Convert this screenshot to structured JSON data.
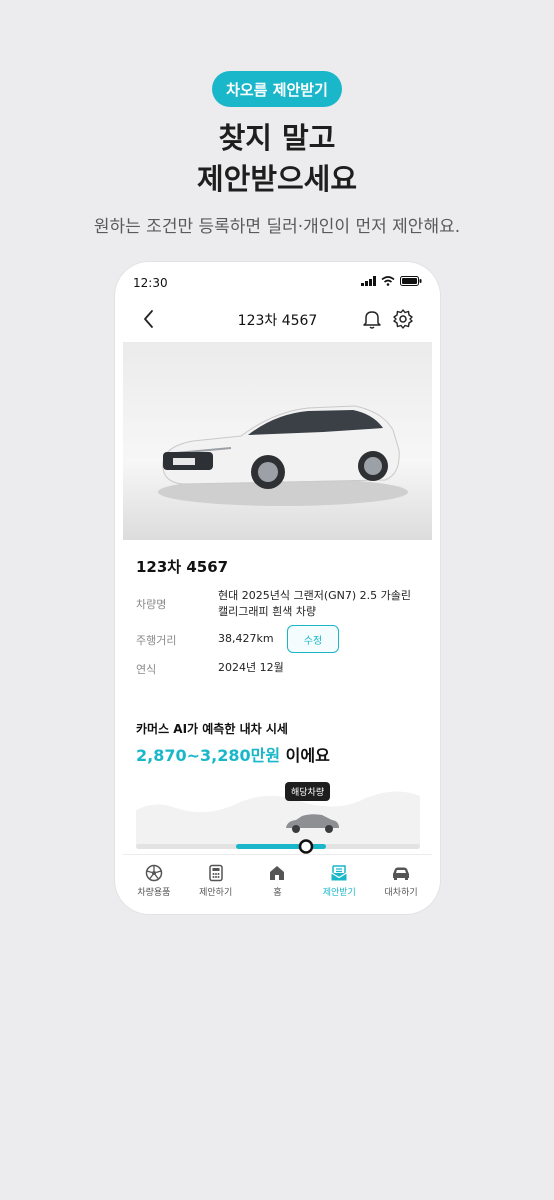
{
  "promo": {
    "badge": "차오름 제안받기",
    "headline_line1": "찾지 말고",
    "headline_line2": "제안받으세요",
    "subline": "원하는 조건만 등록하면 딜러·개인이 먼저 제안해요."
  },
  "status_bar": {
    "time": "12:30"
  },
  "nav": {
    "title": "123차 4567",
    "icons": [
      "back-icon",
      "bell-icon",
      "gear-icon"
    ]
  },
  "car": {
    "plate": "123차 4567",
    "model_label": "차량명",
    "model_line1": "현대 2025년식 그랜저(GN7) 2.5 가솔린",
    "model_line2": "캘리그래피 흰색 차량",
    "mileage_label": "주행거리",
    "mileage": "38,427km",
    "edit_button": "수정",
    "year_label": "연식",
    "year": "2024년 12월"
  },
  "estimate": {
    "label": "카머스 AI가 예측한 내차 시세",
    "range": "2,870~3,280만원",
    "suffix": " 이에요",
    "tag": "해당차량",
    "marker_fraction": 0.6
  },
  "tabs": [
    {
      "label": "차량용품",
      "icon": "wheel-icon"
    },
    {
      "label": "제안하기",
      "icon": "calculator-icon"
    },
    {
      "label": "홈",
      "icon": "home-icon"
    },
    {
      "label": "제안받기",
      "icon": "inbox-icon",
      "active": true
    },
    {
      "label": "대차하기",
      "icon": "car-icon"
    }
  ],
  "colors": {
    "accent": "#19b7c9",
    "background": "#ececee",
    "text": "#111111"
  }
}
